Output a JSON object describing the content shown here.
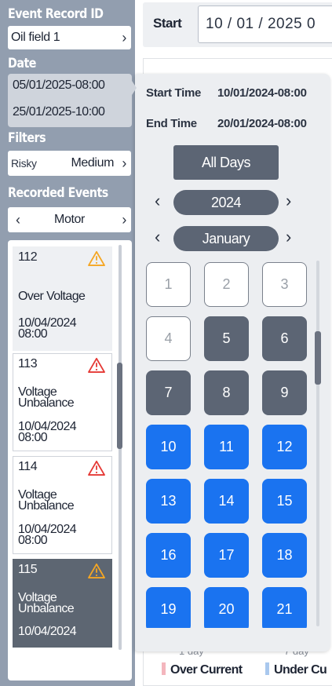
{
  "sidebar": {
    "event_record_heading": "Event Record ID",
    "record_value": "Oil field 1",
    "date_heading": "Date",
    "date_from": "05/01/2025-08:00",
    "date_to": "25/01/2025-10:00",
    "filters_heading": "Filters",
    "filter_label": "Risky",
    "filter_value": "Medium",
    "recorded_heading": "Recorded Events",
    "category_value": "Motor",
    "events": [
      {
        "id": "112",
        "title": "Over Voltage",
        "date": "10/04/2024\n08:00",
        "severity": "warning"
      },
      {
        "id": "113",
        "title": "Voltage\nUnbalance",
        "date": "10/04/2024\n08:00",
        "severity": "critical"
      },
      {
        "id": "114",
        "title": "Voltage\nUnbalance",
        "date": "10/04/2024\n08:00",
        "severity": "critical"
      },
      {
        "id": "115",
        "title": "Voltage\nUnbalance",
        "date": "10/04/2024",
        "severity": "warning"
      }
    ]
  },
  "toolbar": {
    "start_label": "Start",
    "start_value": "10 / 01 / 2025   0"
  },
  "calendar": {
    "start_time_label": "Start Time",
    "start_time_value": "10/01/2024-08:00",
    "end_time_label": "End Time",
    "end_time_value": "20/01/2024-08:00",
    "all_days_label": "All Days",
    "year": "2024",
    "month": "January",
    "days": [
      "1",
      "2",
      "3",
      "4",
      "5",
      "6",
      "7",
      "8",
      "9",
      "10",
      "11",
      "12",
      "13",
      "14",
      "15",
      "16",
      "17",
      "18",
      "19",
      "20",
      "21"
    ],
    "day_states": [
      "out",
      "out",
      "out",
      "out",
      "past",
      "past",
      "past",
      "past",
      "past",
      "sel",
      "sel",
      "sel",
      "sel",
      "sel",
      "sel",
      "sel",
      "sel",
      "sel",
      "sel",
      "sel",
      "sel"
    ]
  },
  "chart_behind": {
    "tick_left": "1 day",
    "tick_right": "7 day",
    "legend": [
      {
        "label": "Over Current",
        "color": "#f4b6bd"
      },
      {
        "label": "Under Cu",
        "color": "#a9c8ee"
      }
    ]
  },
  "colors": {
    "sidebar_bg": "#929eaf",
    "selected_day": "#1a73f0",
    "past_day": "#5c6574",
    "warning": "#f5a623",
    "critical": "#e53935"
  }
}
